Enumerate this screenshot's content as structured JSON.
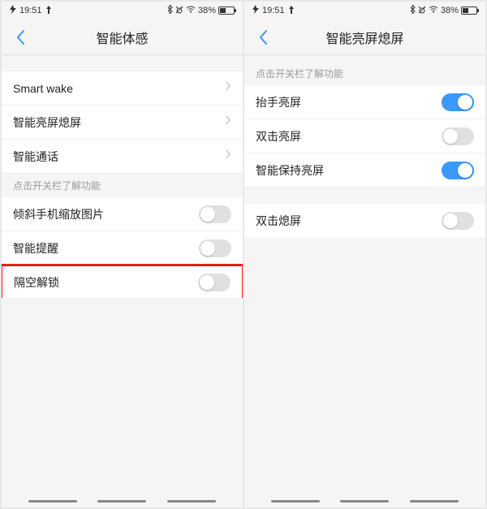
{
  "status": {
    "time": "19:51",
    "battery_pct": "38%"
  },
  "left": {
    "title": "智能体感",
    "nav_rows": [
      {
        "label": "Smart wake"
      },
      {
        "label": "智能亮屏熄屏"
      },
      {
        "label": "智能通话"
      }
    ],
    "section_header": "点击开关栏了解功能",
    "toggle_rows": [
      {
        "label": "倾斜手机缩放图片",
        "on": false,
        "highlight": false
      },
      {
        "label": "智能提醒",
        "on": false,
        "highlight": false
      },
      {
        "label": "隔空解锁",
        "on": false,
        "highlight": true
      }
    ]
  },
  "right": {
    "title": "智能亮屏熄屏",
    "section_header": "点击开关栏了解功能",
    "group1": [
      {
        "label": "抬手亮屏",
        "on": true
      },
      {
        "label": "双击亮屏",
        "on": false
      },
      {
        "label": "智能保持亮屏",
        "on": true
      }
    ],
    "group2": [
      {
        "label": "双击熄屏",
        "on": false
      }
    ]
  }
}
